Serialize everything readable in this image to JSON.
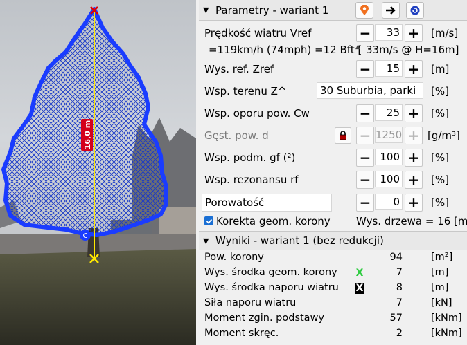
{
  "photo": {
    "height_label": "16,0 m",
    "center_marker": "C"
  },
  "params": {
    "header": "Parametry - wariant 1",
    "header_icons": [
      "location-pin-icon",
      "arrow-right-icon",
      "reset-icon"
    ],
    "wind_speed": {
      "label": "Prędkość wiatru Vref",
      "value": "33",
      "unit": "[m/s]"
    },
    "wind_info": "=119km/h (74mph) =12 Bft [",
    "wind_info_tail": "33m/s @ H=16m]",
    "ref_height": {
      "label": "Wys. ref. Zref",
      "value": "15",
      "unit": "[m]"
    },
    "terrain": {
      "label": "Wsp. terenu  Z^",
      "value": "30 Suburbia, parki",
      "unit": "[%]"
    },
    "drag": {
      "label": "Wsp. oporu pow. Cw",
      "value": "25",
      "unit": "[%]"
    },
    "density": {
      "label": "Gęst. pow. d",
      "value": "1250",
      "unit": "[g/m³]"
    },
    "gust": {
      "label": "Wsp. podm. gf (²)",
      "value": "100",
      "unit": "[%]"
    },
    "resonance": {
      "label": "Wsp. rezonansu rf",
      "value": "100",
      "unit": "[%]"
    },
    "porosity": {
      "label": "Porowatość",
      "value": "0",
      "unit": "[%]"
    },
    "crown_correction": {
      "label": "Korekta geom. korony",
      "checked": true
    },
    "tree_height": "Wys. drzewa = 16 [m]"
  },
  "results": {
    "header": "Wyniki - wariant 1 (bez redukcji)",
    "rows": [
      {
        "label": "Pow. korony",
        "value": "94",
        "unit": "[m²]"
      },
      {
        "label": "Wys. środka geom. korony",
        "value": "7",
        "unit": "[m]",
        "marker": "X"
      },
      {
        "label": "Wys. środka naporu wiatru",
        "value": "8",
        "unit": "[m]",
        "marker": "X"
      },
      {
        "label": "Siła naporu wiatru",
        "value": "7",
        "unit": "[kN]"
      },
      {
        "label": "Moment zgin. podstawy",
        "value": "57",
        "unit": "[kNm]"
      },
      {
        "label": "Moment skręc.",
        "value": "2",
        "unit": "[kNm]"
      }
    ]
  },
  "colors": {
    "outline": "#1a3cff",
    "hatch": "#1838c8",
    "measure": "#ffe800",
    "label_bg": "#d4001a",
    "marker_green": "#2ecc40"
  }
}
